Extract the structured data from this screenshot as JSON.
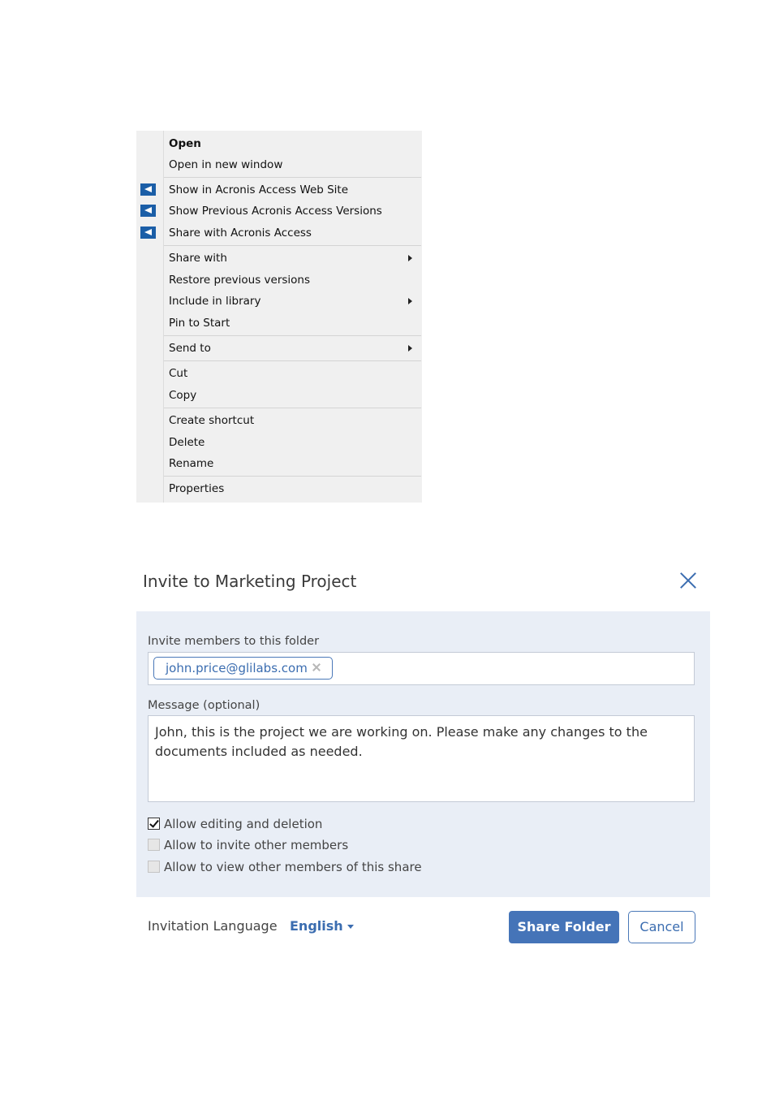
{
  "context_menu": {
    "groups": [
      [
        {
          "label": "Open",
          "bold": true
        },
        {
          "label": "Open in new window"
        }
      ],
      [
        {
          "label": "Show in Acronis Access Web Site",
          "icon": "acronis-access-icon"
        },
        {
          "label": "Show Previous Acronis Access Versions",
          "icon": "acronis-access-icon"
        },
        {
          "label": "Share with Acronis Access",
          "icon": "acronis-access-icon"
        }
      ],
      [
        {
          "label": "Share with",
          "submenu": true
        },
        {
          "label": "Restore previous versions"
        },
        {
          "label": "Include in library",
          "submenu": true
        },
        {
          "label": "Pin to Start"
        }
      ],
      [
        {
          "label": "Send to",
          "submenu": true
        }
      ],
      [
        {
          "label": "Cut"
        },
        {
          "label": "Copy"
        }
      ],
      [
        {
          "label": "Create shortcut"
        },
        {
          "label": "Delete"
        },
        {
          "label": "Rename"
        }
      ],
      [
        {
          "label": "Properties"
        }
      ]
    ]
  },
  "dialog": {
    "title": "Invite to Marketing Project",
    "close_icon": "close-icon",
    "invite_label": "Invite members to this folder",
    "invitees": [
      "john.price@glilabs.com"
    ],
    "message_label": "Message (optional)",
    "message_value": "John, this is the project we are working on. Please make any changes to the documents included as needed.",
    "options": [
      {
        "label": "Allow editing and deletion",
        "checked": true
      },
      {
        "label": "Allow to invite other members",
        "checked": false
      },
      {
        "label": "Allow to view other members of this share",
        "checked": false
      }
    ],
    "language_label": "Invitation Language",
    "language_value": "English",
    "share_button": "Share Folder",
    "cancel_button": "Cancel"
  },
  "colors": {
    "accent": "#4574b8",
    "panel_bg": "#e9eef6",
    "menu_bg": "#f0f0f0",
    "acronis_icon": "#1b5ea7"
  }
}
